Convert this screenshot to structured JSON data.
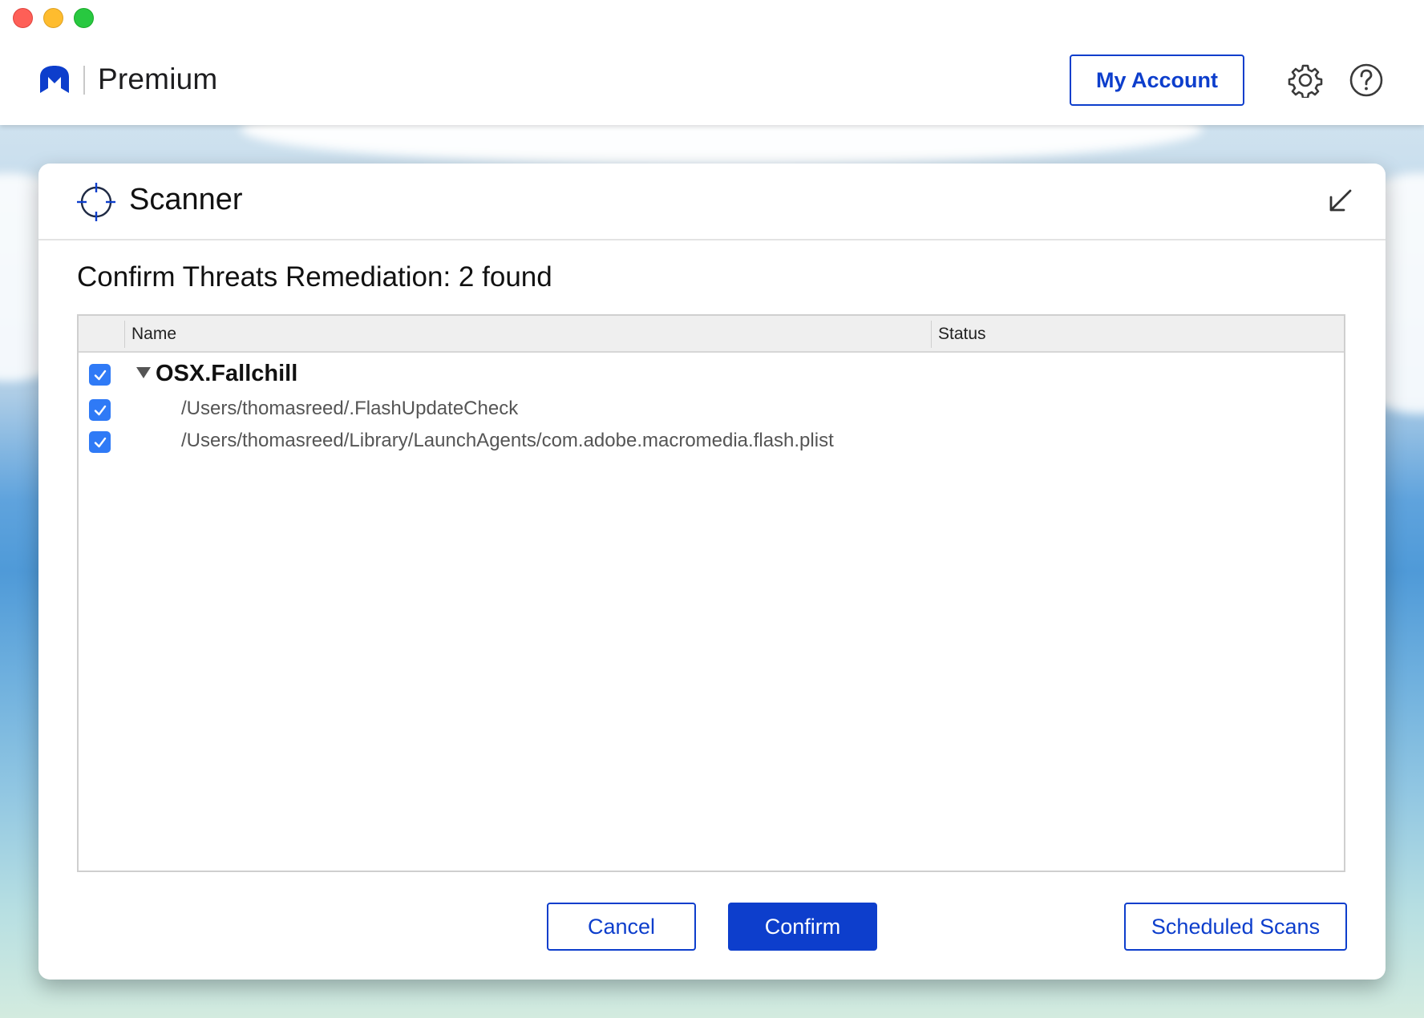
{
  "header": {
    "product": "Premium",
    "my_account_label": "My Account",
    "logo_icon": "malwarebytes-logo-icon",
    "settings_icon": "gear-icon",
    "help_icon": "help-circle-icon",
    "accent_color": "#0d3ecc"
  },
  "scanner": {
    "title": "Scanner",
    "heading": "Confirm Threats Remediation: 2 found"
  },
  "table": {
    "columns": [
      "Name",
      "Status"
    ],
    "threat": {
      "name": "OSX.Fallchill",
      "checked": true,
      "items": [
        {
          "path": "/Users/thomasreed/.FlashUpdateCheck",
          "checked": true
        },
        {
          "path": "/Users/thomasreed/Library/LaunchAgents/com.adobe.macromedia.flash.plist",
          "checked": true
        }
      ]
    }
  },
  "buttons": {
    "cancel": "Cancel",
    "confirm": "Confirm",
    "scheduled_scans": "Scheduled Scans"
  }
}
